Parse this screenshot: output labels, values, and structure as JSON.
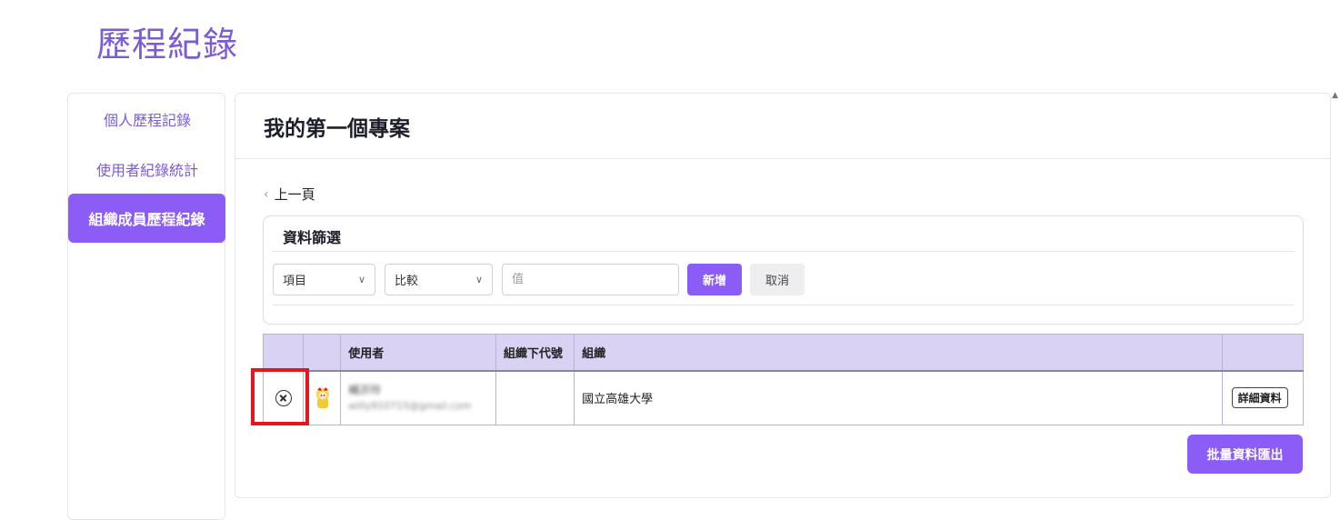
{
  "header": {
    "title": "歷程紀錄"
  },
  "sidebar": {
    "items": [
      {
        "label": "個人歷程記錄",
        "active": false
      },
      {
        "label": "使用者紀錄統計",
        "active": false
      },
      {
        "label": "組織成員歷程紀錄",
        "active": true
      }
    ]
  },
  "panel": {
    "title": "我的第一個專案",
    "back_label": "上一頁"
  },
  "filter": {
    "title": "資料篩選",
    "item_select": "項目",
    "compare_select": "比較",
    "value_placeholder": "值",
    "add_label": "新增",
    "cancel_label": "取消"
  },
  "table": {
    "headers": [
      "",
      "",
      "使用者",
      "組織下代號",
      "組織",
      ""
    ],
    "rows": [
      {
        "user_name": "楊沂玲",
        "user_email": "willy910715@gmail.com",
        "org_code": "",
        "org": "國立高雄大學",
        "detail_label": "詳細資料"
      }
    ]
  },
  "export_label": "批量資料匯出",
  "colors": {
    "accent": "#8b5cf6",
    "title": "#7b5bd6",
    "table_header": "#d9d2f3",
    "highlight": "#e5161d"
  }
}
